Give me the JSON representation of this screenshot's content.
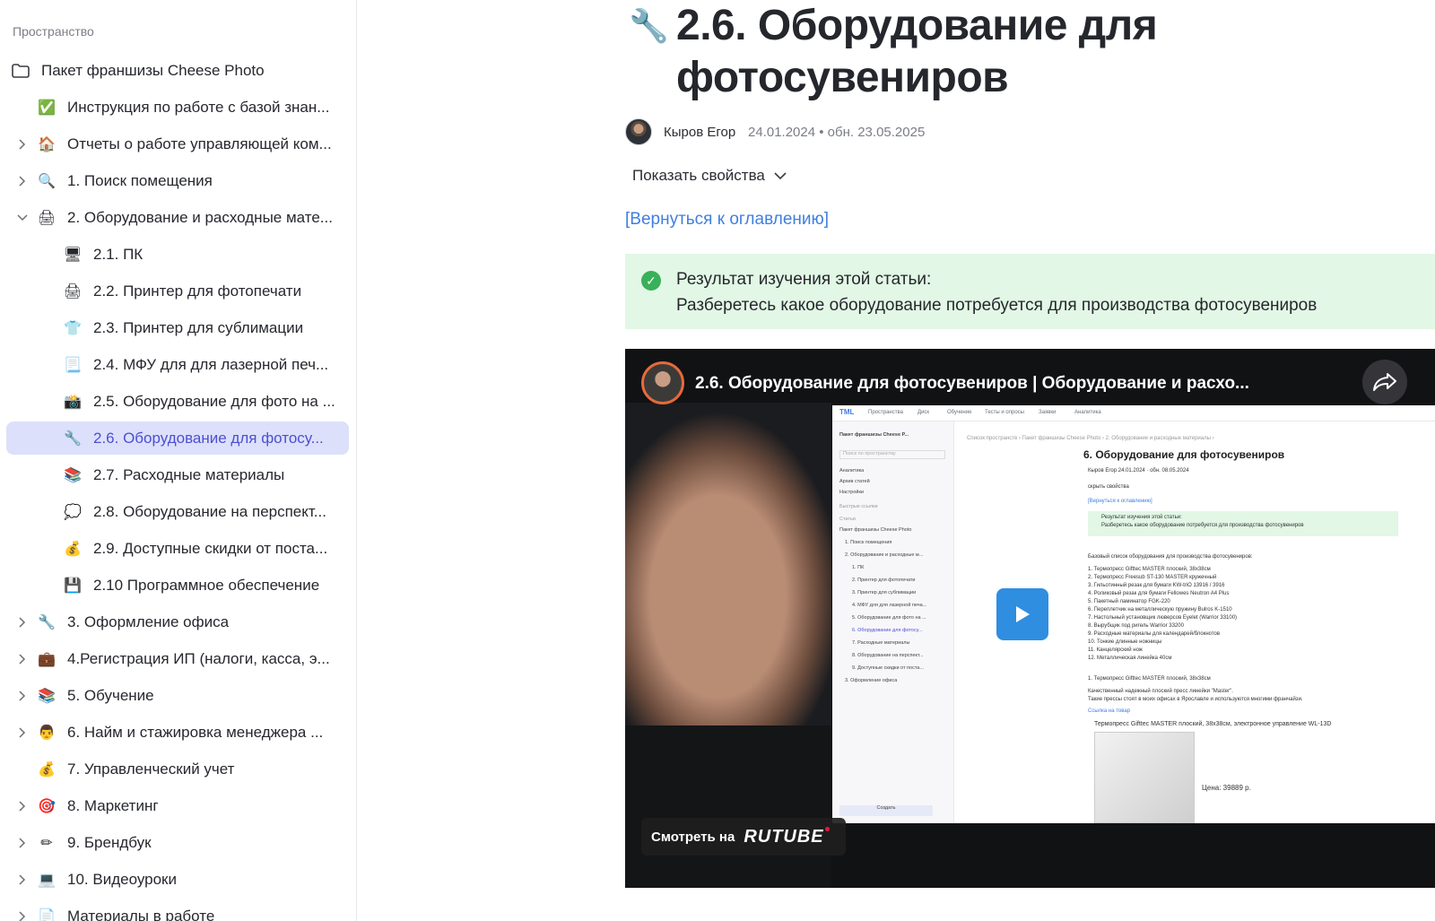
{
  "sidebar": {
    "section_label": "Пространство",
    "root": {
      "label": "Пакет франшизы Cheese Photo",
      "icon": "folder-icon"
    },
    "items": [
      {
        "label": "Инструкция по работе с базой знан...",
        "icon": "✅",
        "expandable": false
      },
      {
        "label": "Отчеты о работе управляющей ком...",
        "icon": "🏠",
        "expandable": true
      },
      {
        "label": "1. Поиск помещения",
        "icon": "🔍",
        "expandable": true
      },
      {
        "label": "2. Оборудование и расходные мате...",
        "icon": "🖨",
        "expandable": true,
        "expanded": true
      },
      {
        "label": "3. Оформление офиса",
        "icon": "🔧",
        "expandable": true
      },
      {
        "label": "4.Регистрация ИП (налоги, касса, э...",
        "icon": "💼",
        "expandable": true
      },
      {
        "label": "5. Обучение",
        "icon": "📚",
        "expandable": true
      },
      {
        "label": "6. Найм и стажировка менеджера ...",
        "icon": "👨",
        "expandable": true
      },
      {
        "label": "7. Управленческий учет",
        "icon": "💰",
        "expandable": false
      },
      {
        "label": "8. Маркетинг",
        "icon": "🎯",
        "expandable": true
      },
      {
        "label": "9. Брендбук",
        "icon": "✏",
        "expandable": true
      },
      {
        "label": "10. Видеоуроки",
        "icon": "💻",
        "expandable": true
      },
      {
        "label": "Материалы в работе",
        "icon": "📄",
        "expandable": true
      }
    ],
    "children": [
      {
        "label": "2.1. ПК",
        "icon": "🖥"
      },
      {
        "label": "2.2. Принтер для фотопечати",
        "icon": "🖨"
      },
      {
        "label": "2.3. Принтер для сублимации",
        "icon": "👕"
      },
      {
        "label": "2.4. МФУ для для лазерной печ...",
        "icon": "📃"
      },
      {
        "label": "2.5. Оборудование для фото на ...",
        "icon": "📸"
      },
      {
        "label": "2.6. Оборудование для фотосу...",
        "icon": "🔧",
        "active": true
      },
      {
        "label": "2.7. Расходные материалы",
        "icon": "📚"
      },
      {
        "label": "2.8. Оборудование на перспект...",
        "icon": "💭"
      },
      {
        "label": "2.9. Доступные скидки от поста...",
        "icon": "💰"
      },
      {
        "label": "2.10 Программное обеспечение",
        "icon": "💾"
      }
    ]
  },
  "article": {
    "title_icon": "🔧",
    "title": "2.6. Оборудование для фотосувениров",
    "author": "Кыров Егор",
    "dates": "24.01.2024 • обн. 23.05.2025",
    "show_props": "Показать свойства",
    "back_link": "[Вернуться к оглавлению]",
    "callout": {
      "line1": "Результат изучения этой статьи:",
      "line2": "Разберетесь какое оборудование потребуется для производства фотосувениров",
      "color": "#e2f7e5"
    }
  },
  "video": {
    "title": "2.6. Оборудование для фотосувениров | Оборудование и расхо...",
    "watch_on": "Смотреть на",
    "platform": "RUTUBE",
    "play_color": "#2f8ee0"
  },
  "accent_color": "#4d4fd1",
  "link_color": "#3f7fe0"
}
